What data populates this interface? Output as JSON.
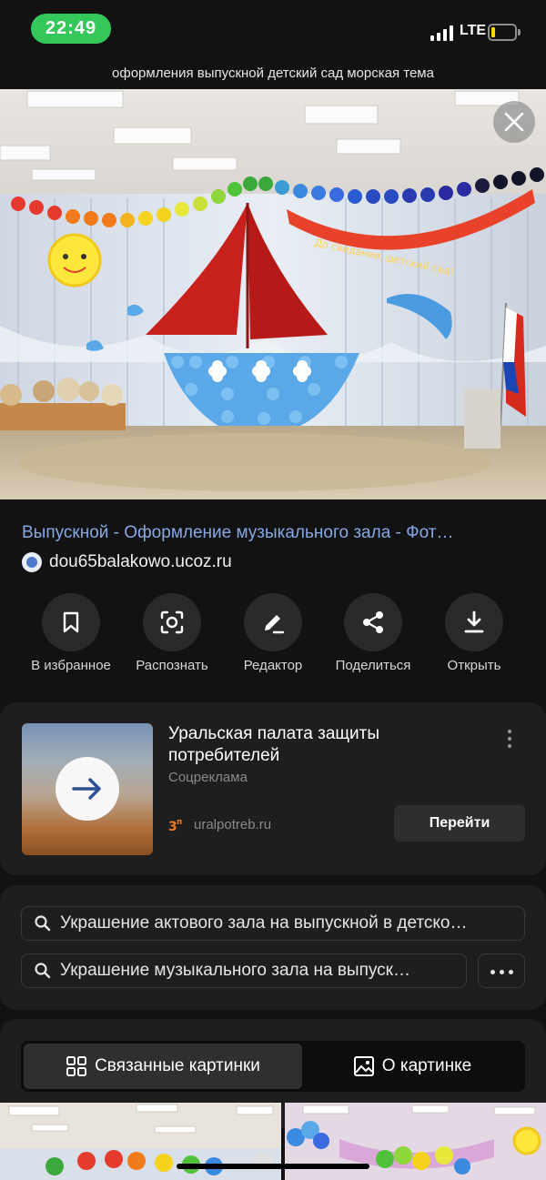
{
  "status_bar": {
    "time": "22:49",
    "network": "LTE"
  },
  "query": "оформления выпускной детский сад морская тема",
  "image": {
    "banner_text": "До свидания, детский сад!"
  },
  "result": {
    "title": "Выпускной - Оформление музыкального зала - Фот…",
    "domain": "dou65balakowo.ucoz.ru"
  },
  "actions": [
    {
      "label": "В избранное",
      "icon": "bookmark-icon"
    },
    {
      "label": "Распознать",
      "icon": "scan-icon"
    },
    {
      "label": "Редактор",
      "icon": "pencil-icon"
    },
    {
      "label": "Поделиться",
      "icon": "share-icon"
    },
    {
      "label": "Открыть",
      "icon": "download-icon"
    }
  ],
  "ad": {
    "title": "Уральская палата защиты потребителей",
    "subtitle": "Соцреклама",
    "domain": "uralpotreb.ru",
    "button": "Перейти"
  },
  "suggestions": [
    "Украшение актового зала на выпускной в детско…",
    "Украшение музыкального зала на выпуск…"
  ],
  "tabs": [
    {
      "label": "Связанные картинки",
      "icon": "grid-icon",
      "active": true
    },
    {
      "label": "О картинке",
      "icon": "image-icon",
      "active": false
    }
  ],
  "colors": {
    "accent_link": "#86a9e6",
    "time_pill": "#34c759",
    "background": "#121212",
    "card": "#1e1e1e"
  }
}
